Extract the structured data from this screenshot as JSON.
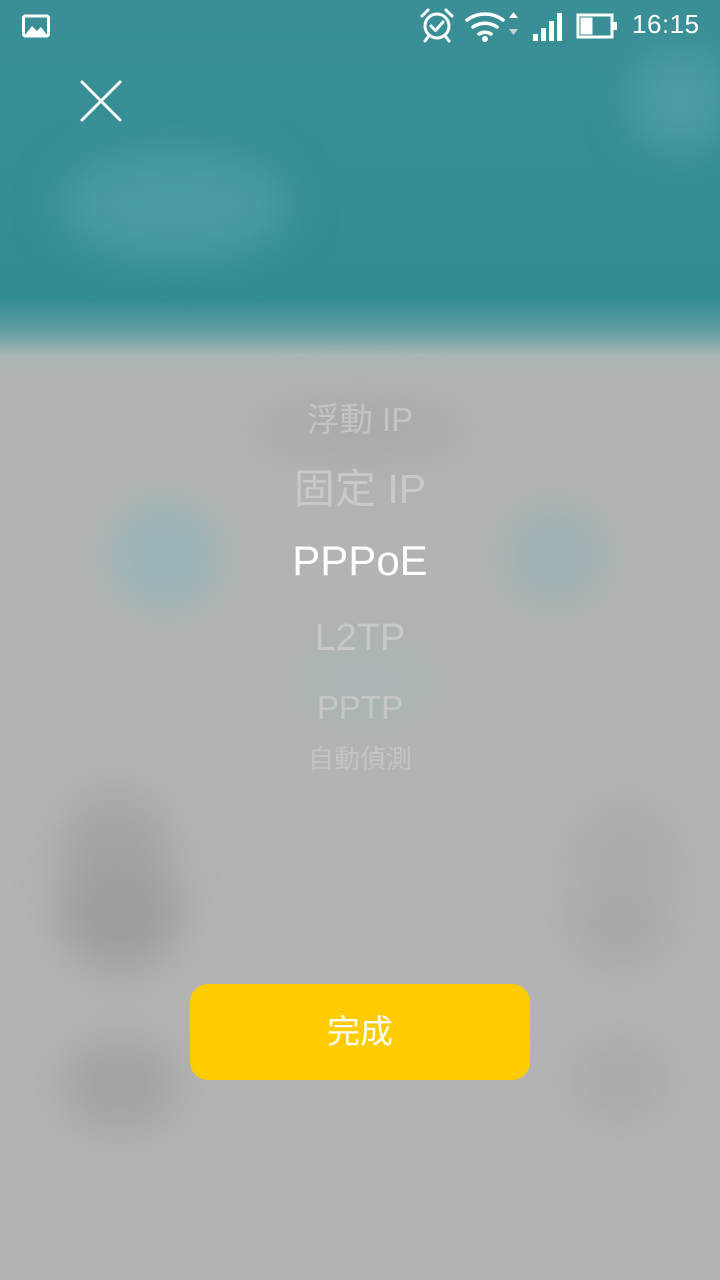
{
  "status_bar": {
    "time": "16:15",
    "icons": [
      "gallery-icon",
      "alarm-icon",
      "wifi-icon",
      "signal-icon",
      "battery-icon"
    ]
  },
  "picker": {
    "options": [
      "浮動 IP",
      "固定 IP",
      "PPPoE",
      "L2TP",
      "PPTP",
      "自動偵測"
    ],
    "selected": "PPPoE"
  },
  "done_button": {
    "label": "完成"
  },
  "colors": {
    "header_teal": "#348c93",
    "overlay_gray": "#b3b3b3",
    "accent_yellow": "#ffcc00",
    "text_white": "#ffffff",
    "text_faded": "#c9c9c9"
  }
}
